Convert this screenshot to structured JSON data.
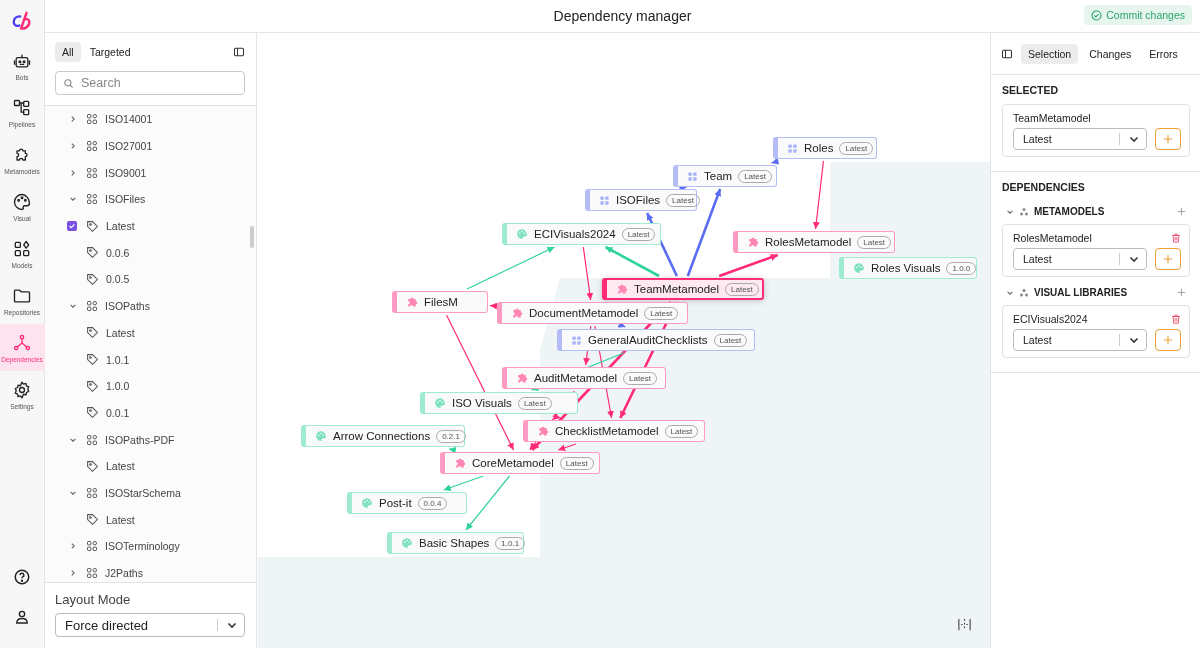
{
  "header": {
    "title": "Dependency manager",
    "commit_button": "Commit changes"
  },
  "nav": [
    {
      "label": "Bots",
      "kind": "bot",
      "selected": false
    },
    {
      "label": "Pipelines",
      "kind": "pipeline",
      "selected": false
    },
    {
      "label": "Metamodels",
      "kind": "puzzle",
      "selected": false
    },
    {
      "label": "Visual",
      "kind": "palette",
      "selected": false
    },
    {
      "label": "Models",
      "kind": "shapes",
      "selected": false
    },
    {
      "label": "Repositories",
      "kind": "folder",
      "selected": false
    },
    {
      "label": "Dependencies",
      "kind": "network",
      "selected": true
    },
    {
      "label": "Settings",
      "kind": "gear",
      "selected": false
    }
  ],
  "tree_panel": {
    "tabs": [
      {
        "label": "All",
        "selected": true
      },
      {
        "label": "Targeted",
        "selected": false
      }
    ],
    "search": {
      "placeholder": "Search"
    },
    "items": [
      {
        "label": "ISO14001",
        "kind": "model",
        "expanded": false
      },
      {
        "label": "ISO27001",
        "kind": "model",
        "expanded": false
      },
      {
        "label": "ISO9001",
        "kind": "model",
        "expanded": false
      },
      {
        "label": "ISOFiles",
        "kind": "model",
        "expanded": true,
        "children": [
          {
            "label": "Latest",
            "kind": "version",
            "checked": true
          },
          {
            "label": "0.0.6",
            "kind": "version",
            "checked": false
          },
          {
            "label": "0.0.5",
            "kind": "version",
            "checked": false
          }
        ]
      },
      {
        "label": "ISOPaths",
        "kind": "model",
        "expanded": true,
        "children": [
          {
            "label": "Latest",
            "kind": "version",
            "checked": false
          },
          {
            "label": "1.0.1",
            "kind": "version",
            "checked": false
          },
          {
            "label": "1.0.0",
            "kind": "version",
            "checked": false
          },
          {
            "label": "0.0.1",
            "kind": "version",
            "checked": false
          }
        ]
      },
      {
        "label": "ISOPaths-PDF",
        "kind": "model",
        "expanded": true,
        "children": [
          {
            "label": "Latest",
            "kind": "version",
            "checked": false
          }
        ]
      },
      {
        "label": "ISOStarSchema",
        "kind": "model",
        "expanded": true,
        "children": [
          {
            "label": "Latest",
            "kind": "version",
            "checked": false
          }
        ]
      },
      {
        "label": "ISOTerminology",
        "kind": "model",
        "expanded": false
      },
      {
        "label": "J2Paths",
        "kind": "model",
        "expanded": false
      }
    ],
    "layout_mode": {
      "label": "Layout Mode",
      "value": "Force directed"
    }
  },
  "graph": {
    "nodes": [
      {
        "label": "Roles",
        "kind": "model",
        "version": "Latest",
        "selected": false
      },
      {
        "label": "Team",
        "kind": "model",
        "version": "Latest",
        "selected": false
      },
      {
        "label": "ISOFiles",
        "kind": "model",
        "version": "Latest",
        "selected": false
      },
      {
        "label": "ECIVisuals2024",
        "kind": "visual",
        "version": "Latest",
        "selected": false
      },
      {
        "label": "RolesMetamodel",
        "kind": "metamodel",
        "version": "Latest",
        "selected": false
      },
      {
        "label": "Roles Visuals",
        "kind": "visual",
        "version": "1.0.0",
        "selected": false
      },
      {
        "label": "TeamMetamodel",
        "kind": "metamodel",
        "version": "Latest",
        "selected": true
      },
      {
        "label": "FilesM",
        "kind": "metamodel",
        "selected": false
      },
      {
        "label": "DocumentMetamodel",
        "kind": "metamodel",
        "version": "Latest",
        "selected": false
      },
      {
        "label": "GeneralAuditChecklists",
        "kind": "model",
        "version": "Latest",
        "selected": false
      },
      {
        "label": "AuditMetamodel",
        "kind": "metamodel",
        "version": "Latest",
        "selected": false
      },
      {
        "label": "ISO Visuals",
        "kind": "visual",
        "version": "Latest",
        "selected": false
      },
      {
        "label": "Arrow Connections",
        "kind": "visual",
        "version": "0.2.1",
        "selected": false
      },
      {
        "label": "ChecklistMetamodel",
        "kind": "metamodel",
        "version": "Latest",
        "selected": false
      },
      {
        "label": "CoreMetamodel",
        "kind": "metamodel",
        "version": "Latest",
        "selected": false
      },
      {
        "label": "Post-it",
        "kind": "visual",
        "version": "0.0.4",
        "selected": false
      },
      {
        "label": "Basic Shapes",
        "kind": "visual",
        "version": "1.0.1",
        "selected": false
      }
    ]
  },
  "right_panel": {
    "tabs": [
      {
        "label": "Selection",
        "selected": true
      },
      {
        "label": "Changes",
        "selected": false
      },
      {
        "label": "Errors",
        "selected": false
      }
    ],
    "selected": {
      "heading": "SELECTED",
      "name": "TeamMetamodel",
      "version": "Latest"
    },
    "dependencies": {
      "heading": "DEPENDENCIES",
      "groups": [
        {
          "label": "METAMODELS",
          "expanded": true,
          "items": [
            {
              "name": "RolesMetamodel",
              "version": "Latest"
            }
          ]
        },
        {
          "label": "VISUAL LIBRARIES",
          "expanded": true,
          "items": [
            {
              "name": "ECIVisuals2024",
              "version": "Latest"
            }
          ]
        }
      ]
    }
  }
}
